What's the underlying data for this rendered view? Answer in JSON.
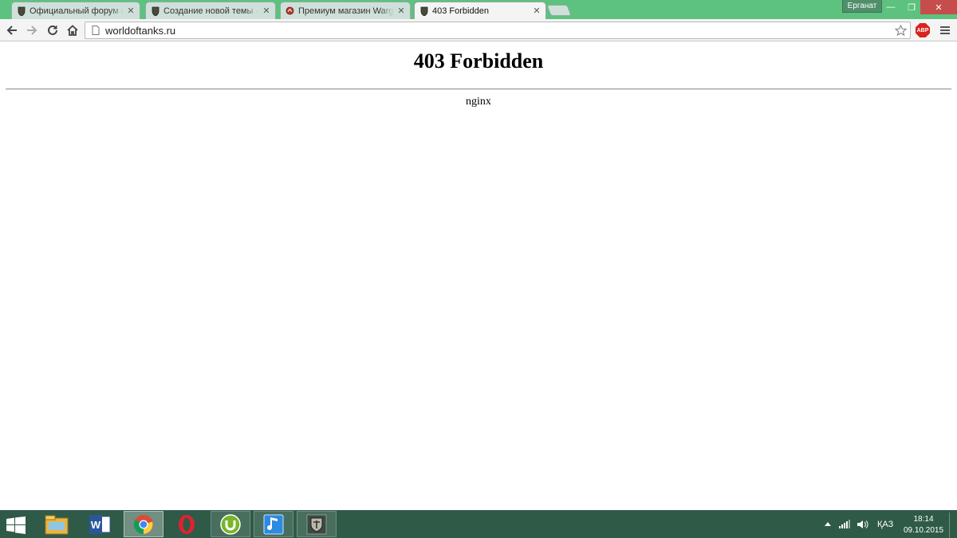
{
  "browser": {
    "tabs": [
      {
        "title": "Официальный форум иг",
        "favicon": "wot-shield-icon",
        "active": false
      },
      {
        "title": "Создание новой темы - (",
        "favicon": "wot-shield-icon",
        "active": false
      },
      {
        "title": "Премиум магазин Warga",
        "favicon": "wargaming-icon",
        "active": false
      },
      {
        "title": "403 Forbidden",
        "favicon": "wot-shield-icon",
        "active": true
      }
    ],
    "tab_close_glyph": "✕",
    "user_name": "Ерганат",
    "window_controls": {
      "minimize": "—",
      "maximize": "❐",
      "close": "✕"
    },
    "address": "worldoftanks.ru",
    "extension_label": "ABP",
    "colors": {
      "frame": "#5dc27f",
      "toolbar": "#f4f4f4",
      "abp": "#d9231f"
    }
  },
  "page": {
    "heading": "403 Forbidden",
    "server": "nginx"
  },
  "taskbar": {
    "apps": [
      {
        "name": "file-explorer-icon",
        "active": false
      },
      {
        "name": "word-icon",
        "active": false
      },
      {
        "name": "chrome-icon",
        "active": true
      },
      {
        "name": "opera-icon",
        "active": false
      },
      {
        "name": "utorrent-icon",
        "active": false
      },
      {
        "name": "music-app-icon",
        "active": false
      },
      {
        "name": "world-of-tanks-icon",
        "active": false
      }
    ],
    "language": "ҚАЗ",
    "time": "18:14",
    "date": "09.10.2015",
    "colors": {
      "background": "#2f5a48"
    }
  }
}
